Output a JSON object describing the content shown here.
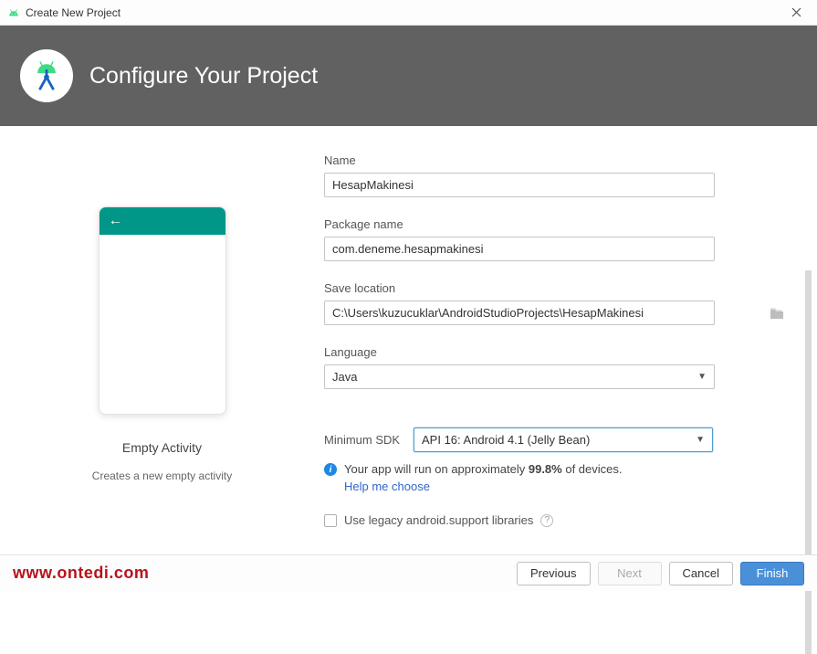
{
  "titlebar": {
    "title": "Create New Project"
  },
  "header": {
    "title": "Configure Your Project"
  },
  "preview": {
    "template_name": "Empty Activity",
    "template_desc": "Creates a new empty activity"
  },
  "form": {
    "name_label": "Name",
    "name_value": "HesapMakinesi",
    "package_label": "Package name",
    "package_value": "com.deneme.hesapmakinesi",
    "save_label": "Save location",
    "save_value": "C:\\Users\\kuzucuklar\\AndroidStudioProjects\\HesapMakinesi",
    "language_label": "Language",
    "language_value": "Java",
    "sdk_label": "Minimum SDK",
    "sdk_value": "API 16: Android 4.1 (Jelly Bean)",
    "info_prefix": "Your app will run on approximately ",
    "info_percent": "99.8%",
    "info_suffix": " of devices.",
    "help_link": "Help me choose",
    "legacy_label": "Use legacy android.support libraries"
  },
  "footer": {
    "watermark": "www.ontedi.com",
    "previous": "Previous",
    "next": "Next",
    "cancel": "Cancel",
    "finish": "Finish"
  }
}
